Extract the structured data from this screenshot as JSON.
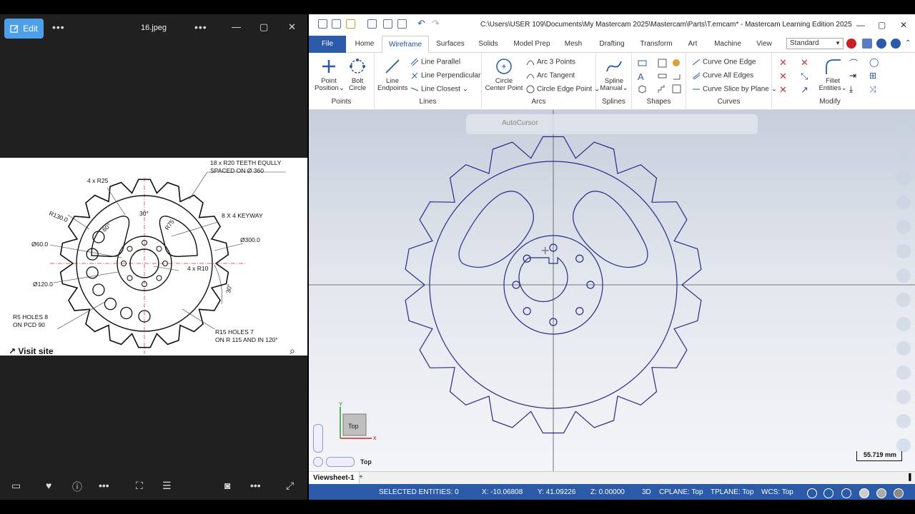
{
  "photo_viewer": {
    "edit_label": "Edit",
    "filename": "16.jpeg",
    "more_label": "•••",
    "visit_site": "Visit site",
    "drawing": {
      "teeth_note_1": "18 x R20 TEETH EQULLY",
      "teeth_note_2": "SPACED ON Ø 360",
      "r25": "4 x R25",
      "r130": "R130.0",
      "keyway": "8 X 4 KEYWAY",
      "ang30": "30°",
      "ang60": "60°",
      "r75": "R75",
      "d300": "Ø300.0",
      "d60": "Ø60.0",
      "r10": "4 x R10",
      "d120": "Ø120.0",
      "ang30b": "30°",
      "r5_1": "R5 HOLES 8",
      "r5_2": "ON PCD 90",
      "r15_1": "R15 HOLES 7",
      "r15_2": "ON R 115 AND IN 120°"
    }
  },
  "mastercam": {
    "title": "C:\\Users\\USER 109\\Documents\\My Mastercam 2025\\Mastercam\\Parts\\T.emcam* - Mastercam Learning Edition 2025",
    "tabs": [
      "File",
      "Home",
      "Wireframe",
      "Surfaces",
      "Solids",
      "Model Prep",
      "Mesh",
      "Drafting",
      "Transform",
      "Art",
      "Machine",
      "View"
    ],
    "standard": "Standard",
    "ribbon": {
      "point_position": [
        "Point",
        "Position"
      ],
      "bolt_circle": [
        "Bolt",
        "Circle"
      ],
      "points_group": "Points",
      "line_endpoints": [
        "Line",
        "Endpoints"
      ],
      "line_parallel": "Line Parallel",
      "line_perpendicular": "Line Perpendicular",
      "line_closest": "Line Closest",
      "lines_group": "Lines",
      "circle_center": [
        "Circle",
        "Center Point"
      ],
      "arc_3_points": "Arc 3 Points",
      "arc_tangent": "Arc Tangent",
      "circle_edge_point": "Circle Edge Point",
      "arcs_group": "Arcs",
      "spline_manual": [
        "Spline",
        "Manual"
      ],
      "splines_group": "Splines",
      "shapes_group": "Shapes",
      "curve_one_edge": "Curve One Edge",
      "curve_all_edges": "Curve All Edges",
      "curve_slice": "Curve Slice by Plane",
      "curves_group": "Curves",
      "fillet_entities": [
        "Fillet",
        "Entities"
      ],
      "modify_group": "Modify"
    },
    "autocursor": "AutoCursor",
    "view_cube": "Top",
    "view_name": "Top",
    "scale": "55.719 mm",
    "axis_x": "x",
    "axis_y": "Y",
    "viewsheet": "Viewsheet-1",
    "status": {
      "selected": "SELECTED ENTITIES: 0",
      "x": "X:   -10.06808",
      "y": "Y:   41.09226",
      "z": "Z:   0.00000",
      "mode": "3D",
      "cplane": "CPLANE: Top",
      "tplane": "TPLANE: Top",
      "wcs": "WCS: Top"
    }
  }
}
